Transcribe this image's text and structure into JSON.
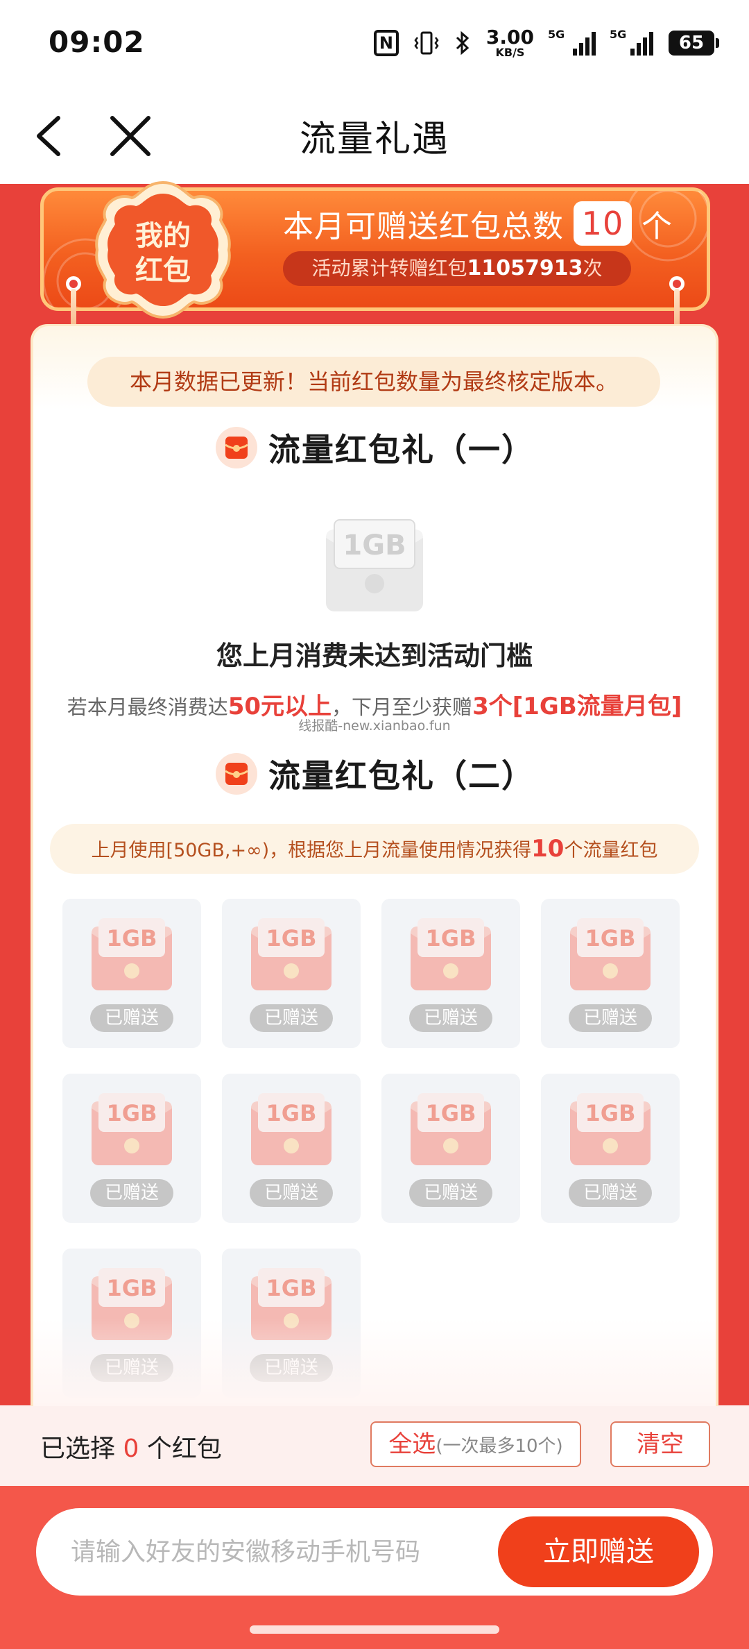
{
  "status_bar": {
    "time": "09:02",
    "nfc": "N",
    "speed_value": "3.00",
    "speed_unit": "KB/S",
    "network_a": "5G",
    "network_b": "5G",
    "battery": "65"
  },
  "nav": {
    "title": "流量礼遇",
    "back_icon": "chevron-left-icon",
    "close_icon": "close-icon"
  },
  "banner": {
    "badge_line1": "我的",
    "badge_line2": "红包",
    "title_prefix": "本月可赠送红包总数",
    "count": "10",
    "title_suffix": "个",
    "sub_prefix": "活动累计转赠红包",
    "sub_count": "11057913",
    "sub_suffix": "次"
  },
  "notice": "本月数据已更新！当前红包数量为最终核定版本。",
  "section1": {
    "title": "流量红包礼（一）",
    "envelope_label": "1GB",
    "status": "您上月消费未达到活动门槛",
    "desc_prefix": "若本月最终消费达",
    "desc_amount": "50元以上",
    "desc_mid": "，下月至少获赠",
    "desc_reward": "3个[1GB流量月包]",
    "watermark": "线报酷-new.xianbao.fun"
  },
  "section2": {
    "title": "流量红包礼（二）",
    "usage_prefix": "上月使用[50GB,+∞)，根据您上月流量使用情况获得",
    "usage_count": "10",
    "usage_suffix": "个流量红包",
    "tile_label": "1GB",
    "tiles": [
      {
        "status": "已赠送"
      },
      {
        "status": "已赠送"
      },
      {
        "status": "已赠送"
      },
      {
        "status": "已赠送"
      },
      {
        "status": "已赠送"
      },
      {
        "status": "已赠送"
      },
      {
        "status": "已赠送"
      },
      {
        "status": "已赠送"
      },
      {
        "status": "已赠送"
      },
      {
        "status": "已赠送"
      }
    ]
  },
  "selection": {
    "prefix": "已选择",
    "count": "0",
    "suffix": "个红包",
    "select_all": "全选",
    "select_all_note": "(一次最多10个)",
    "clear": "清空"
  },
  "send": {
    "placeholder": "请输入好友的安徽移动手机号码",
    "value": "",
    "button": "立即赠送"
  },
  "colors": {
    "brand_red": "#e8413a",
    "banner_orange": "#f36020",
    "send_button": "#f0401b"
  }
}
